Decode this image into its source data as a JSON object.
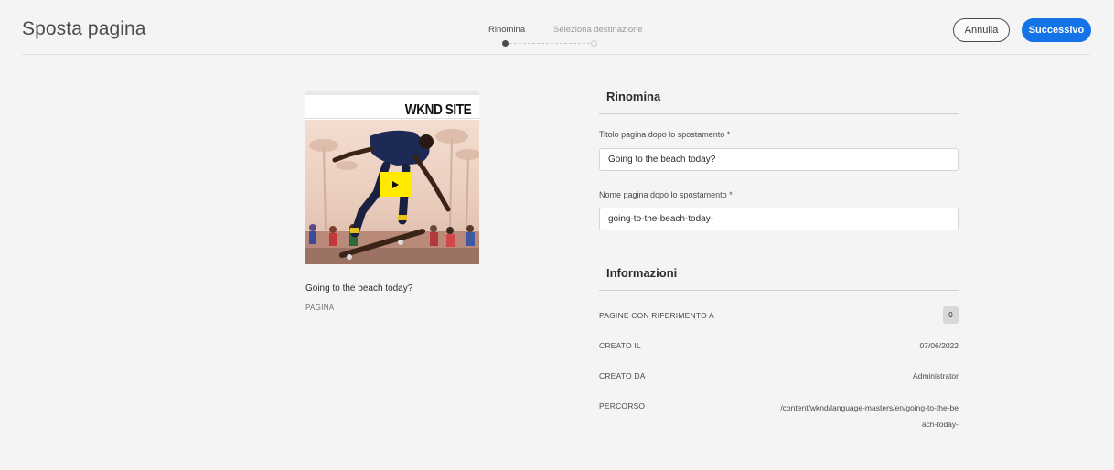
{
  "header": {
    "title": "Sposta pagina",
    "steps": [
      {
        "label": "Rinomina",
        "active": true
      },
      {
        "label": "Seleziona destinazione",
        "active": false
      }
    ],
    "cancel_label": "Annulla",
    "next_label": "Successivo"
  },
  "card": {
    "brand": "WKND SITE",
    "title": "Going to the beach today?",
    "type": "PAGINA",
    "play_icon": "play-icon"
  },
  "rename": {
    "heading": "Rinomina",
    "title_label": "Titolo pagina dopo lo spostamento *",
    "title_value": "Going to the beach today?",
    "name_label": "Nome pagina dopo lo spostamento *",
    "name_value": "going-to-the-beach-today-"
  },
  "info": {
    "heading": "Informazioni",
    "rows": [
      {
        "label": "PAGINE CON RIFERIMENTO A",
        "value": "0"
      },
      {
        "label": "CREATO IL",
        "value": "07/06/2022"
      },
      {
        "label": "CREATO DA",
        "value": "Administrator"
      },
      {
        "label": "PERCORSO",
        "value": "/content/wknd/language-masters/en/going-to-the-beach-today-"
      }
    ]
  },
  "colors": {
    "accent": "#1473e6",
    "play": "#ffea00"
  }
}
